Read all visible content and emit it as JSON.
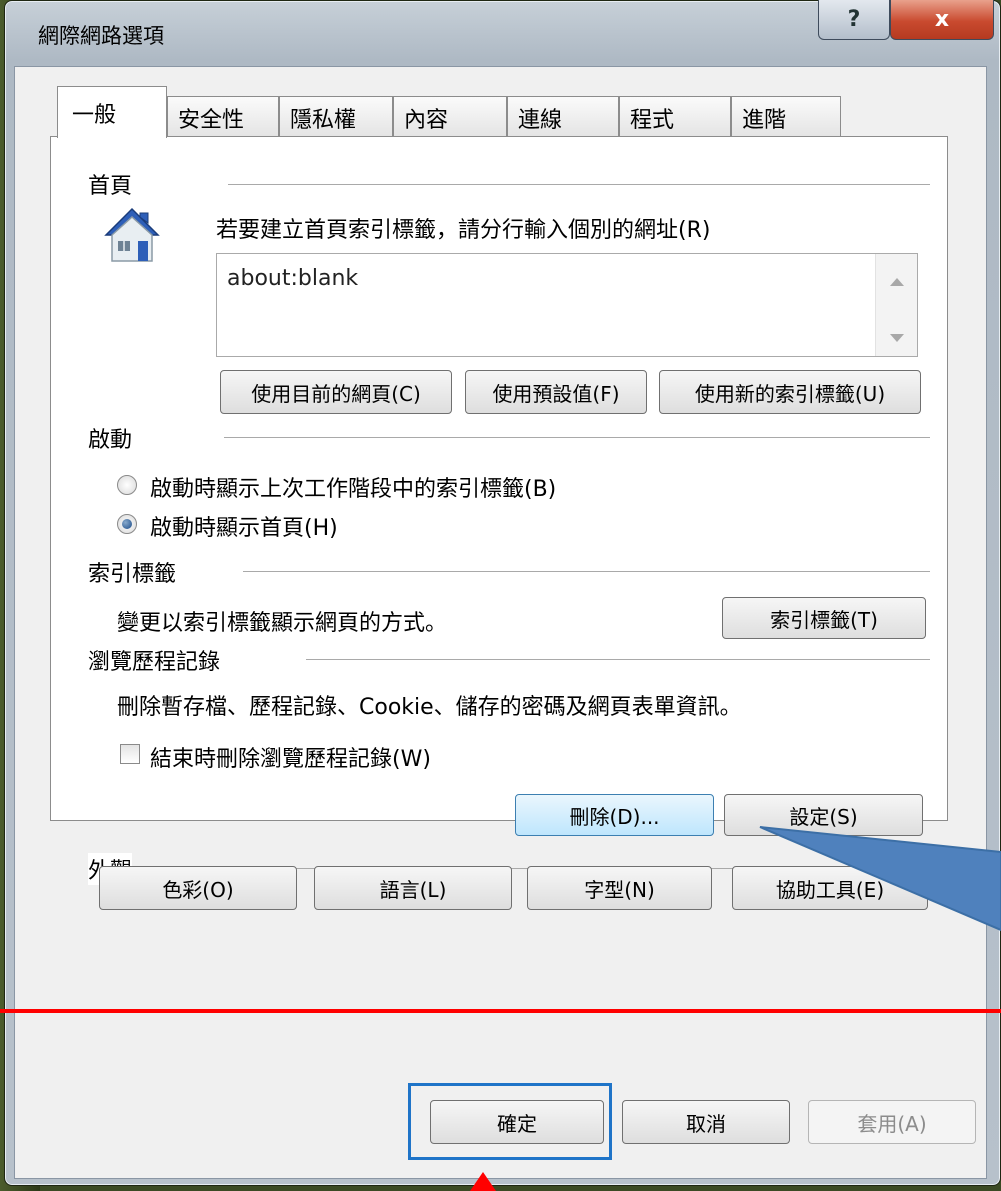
{
  "window": {
    "title": "網際網路選項",
    "help_glyph": "?",
    "close_glyph": "x"
  },
  "tabs": [
    "一般",
    "安全性",
    "隱私權",
    "內容",
    "連線",
    "程式",
    "進階"
  ],
  "home": {
    "section": "首頁",
    "instruction": "若要建立首頁索引標籤，請分行輸入個別的網址(R)",
    "url_value": "about:blank",
    "buttons": [
      "使用目前的網頁(C)",
      "使用預設值(F)",
      "使用新的索引標籤(U)"
    ]
  },
  "startup": {
    "section": "啟動",
    "options": [
      "啟動時顯示上次工作階段中的索引標籤(B)",
      "啟動時顯示首頁(H)"
    ],
    "selected": 1
  },
  "tabs_section": {
    "section": "索引標籤",
    "description": "變更以索引標籤顯示網頁的方式。",
    "button": "索引標籤(T)"
  },
  "history": {
    "section": "瀏覽歷程記錄",
    "description": "刪除暫存檔、歷程記錄、Cookie、儲存的密碼及網頁表單資訊。",
    "checkbox": "結束時刪除瀏覽歷程記錄(W)",
    "checked": false,
    "delete_button": "刪除(D)...",
    "settings_button": "設定(S)"
  },
  "appearance": {
    "section": "外觀",
    "buttons": [
      "色彩(O)",
      "語言(L)",
      "字型(N)",
      "協助工具(E)"
    ]
  },
  "footer": {
    "ok": "確定",
    "cancel": "取消",
    "apply": "套用(A)"
  },
  "annotations": {
    "red_line_color": "#ff0000",
    "highlight_box_color": "#1f74c8",
    "callout_color": "#4f81bd",
    "arrow_color": "#ff0000"
  }
}
